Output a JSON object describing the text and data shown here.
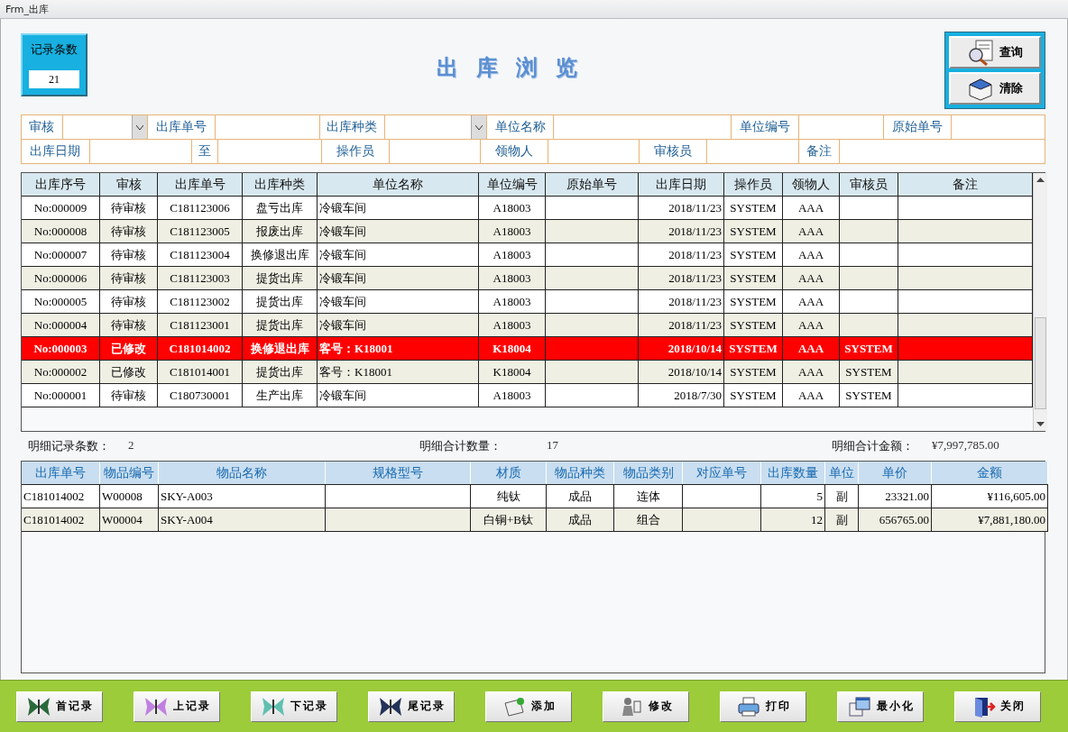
{
  "window": {
    "title": "Frm_出库"
  },
  "record_count": {
    "label": "记录条数",
    "value": "21"
  },
  "title": "出库浏览",
  "query_buttons": [
    {
      "label": "查询",
      "kind": "search"
    },
    {
      "label": "清除",
      "kind": "clear"
    }
  ],
  "filters": [
    [
      {
        "label": "审核",
        "kind": "combo"
      },
      {
        "label": "出库单号",
        "kind": "text"
      },
      {
        "label": "出库种类",
        "kind": "combo"
      },
      {
        "label": "单位名称",
        "kind": "text"
      },
      {
        "label": "单位编号",
        "kind": "text"
      },
      {
        "label": "原始单号",
        "kind": "text"
      }
    ],
    [
      {
        "label": "出库日期",
        "kind": "text"
      },
      {
        "label": "至",
        "kind": "text"
      },
      {
        "label": "操作员",
        "kind": "text"
      },
      {
        "label": "领物人",
        "kind": "text"
      },
      {
        "label": "审核员",
        "kind": "text"
      },
      {
        "label": "备注",
        "kind": "text"
      }
    ]
  ],
  "table": {
    "columns": [
      "出库序号",
      "审核",
      "出库单号",
      "出库种类",
      "单位名称",
      "单位编号",
      "原始单号",
      "出库日期",
      "操作员",
      "领物人",
      "审核员",
      "备注"
    ],
    "rows": [
      {
        "selected": false,
        "cells": [
          "No:000009",
          "待审核",
          "C181123006",
          "盘亏出库",
          "冷锻车间",
          "A18003",
          "",
          "2018/11/23",
          "SYSTEM",
          "AAA",
          "",
          ""
        ]
      },
      {
        "selected": false,
        "cells": [
          "No:000008",
          "待审核",
          "C181123005",
          "报废出库",
          "冷锻车间",
          "A18003",
          "",
          "2018/11/23",
          "SYSTEM",
          "AAA",
          "",
          ""
        ]
      },
      {
        "selected": false,
        "cells": [
          "No:000007",
          "待审核",
          "C181123004",
          "换修退出库",
          "冷锻车间",
          "A18003",
          "",
          "2018/11/23",
          "SYSTEM",
          "AAA",
          "",
          ""
        ]
      },
      {
        "selected": false,
        "cells": [
          "No:000006",
          "待审核",
          "C181123003",
          "提货出库",
          "冷锻车间",
          "A18003",
          "",
          "2018/11/23",
          "SYSTEM",
          "AAA",
          "",
          ""
        ]
      },
      {
        "selected": false,
        "cells": [
          "No:000005",
          "待审核",
          "C181123002",
          "提货出库",
          "冷锻车间",
          "A18003",
          "",
          "2018/11/23",
          "SYSTEM",
          "AAA",
          "",
          ""
        ]
      },
      {
        "selected": false,
        "cells": [
          "No:000004",
          "待审核",
          "C181123001",
          "提货出库",
          "冷锻车间",
          "A18003",
          "",
          "2018/11/23",
          "SYSTEM",
          "AAA",
          "",
          ""
        ]
      },
      {
        "selected": true,
        "cells": [
          "No:000003",
          "已修改",
          "C181014002",
          "换修退出库",
          "客号：K18001",
          "K18004",
          "",
          "2018/10/14",
          "SYSTEM",
          "AAA",
          "SYSTEM",
          ""
        ]
      },
      {
        "selected": false,
        "cells": [
          "No:000002",
          "已修改",
          "C181014001",
          "提货出库",
          "客号：K18001",
          "K18004",
          "",
          "2018/10/14",
          "SYSTEM",
          "AAA",
          "SYSTEM",
          ""
        ]
      },
      {
        "selected": false,
        "cells": [
          "No:000001",
          "待审核",
          "C180730001",
          "生产出库",
          "冷锻车间",
          "A18003",
          "",
          "2018/7/30",
          "SYSTEM",
          "AAA",
          "SYSTEM",
          ""
        ]
      }
    ]
  },
  "detail_summary": [
    {
      "label": "明细记录条数：",
      "value": "2"
    },
    {
      "label": "明细合计数量：",
      "value": "17"
    },
    {
      "label": "明细合计金额：",
      "value": "¥7,997,785.00"
    }
  ],
  "detail_table": {
    "columns": [
      "出库单号",
      "物品编号",
      "物品名称",
      "规格型号",
      "材质",
      "物品种类",
      "物品类别",
      "对应单号",
      "出库数量",
      "单位",
      "单价",
      "金额"
    ],
    "rows": [
      {
        "cells": [
          "C181014002",
          "W00008",
          "SKY-A003",
          "",
          "纯钛",
          "成品",
          "连体",
          "",
          "5",
          "副",
          "23321.00",
          "¥116,605.00"
        ]
      },
      {
        "cells": [
          "C181014002",
          "W00004",
          "SKY-A004",
          "",
          "白铜+B钛",
          "成品",
          "组合",
          "",
          "12",
          "副",
          "656765.00",
          "¥7,881,180.00"
        ]
      }
    ]
  },
  "nav_buttons": [
    {
      "label": "首记录",
      "kind": "first"
    },
    {
      "label": "上记录",
      "kind": "prev"
    },
    {
      "label": "下记录",
      "kind": "next"
    },
    {
      "label": "尾记录",
      "kind": "last"
    },
    {
      "label": "添加",
      "kind": "add"
    },
    {
      "label": "修改",
      "kind": "edit"
    },
    {
      "label": "打印",
      "kind": "print"
    },
    {
      "label": "最小化",
      "kind": "minimize"
    },
    {
      "label": "关闭",
      "kind": "close"
    }
  ]
}
